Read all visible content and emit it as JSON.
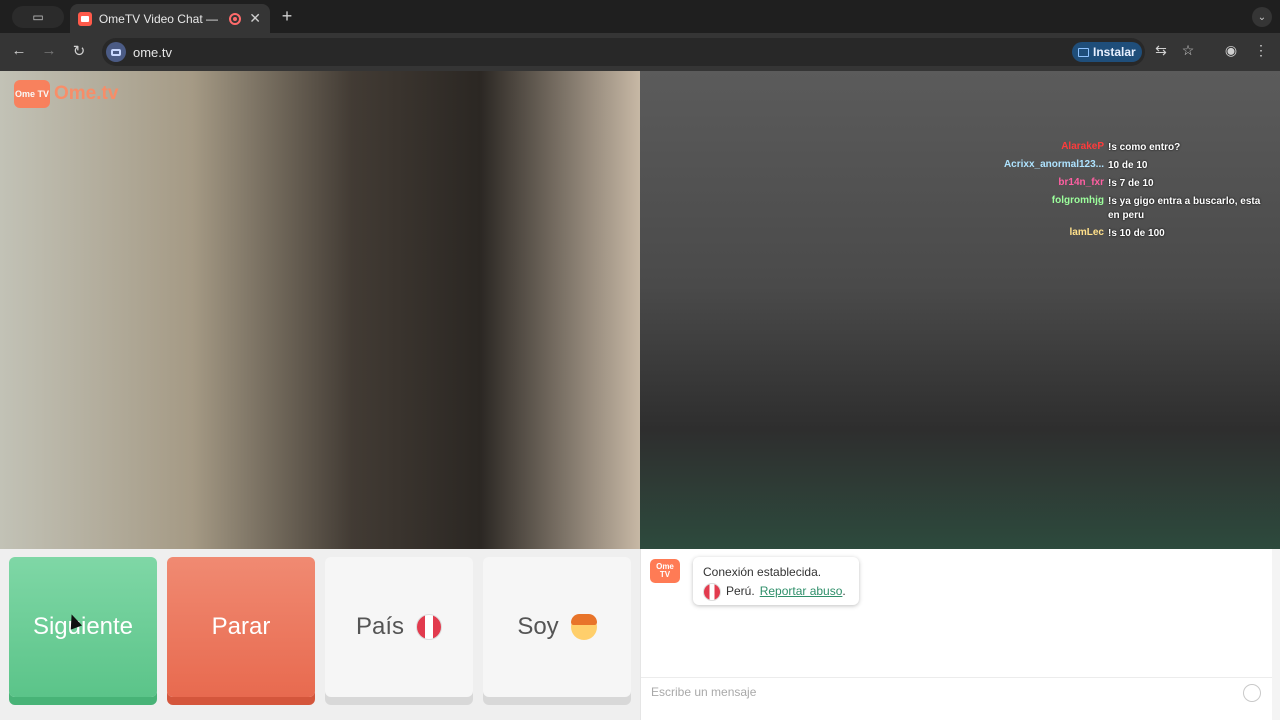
{
  "browser": {
    "tab_title": "OmeTV Video Chat — Ome",
    "tab_close": "✕",
    "new_tab": "+",
    "url": "ome.tv",
    "install_label": "Instalar"
  },
  "site": {
    "logo_icon_text": "Ome TV",
    "logo_text": "Ome.tv"
  },
  "stream_chat": [
    {
      "user": "AlarakeP",
      "message": "!s como entro?",
      "color": "#ff3b3b"
    },
    {
      "user": "Acrixx_anormal123...",
      "message": "10 de 10",
      "color": "#aee3ff"
    },
    {
      "user": "br14n_fxr",
      "message": "!s 7 de 10",
      "color": "#ff5fa2"
    },
    {
      "user": "folgromhjg",
      "message": "!s ya gigo entra a buscarlo, esta en peru",
      "color": "#9cff9c"
    },
    {
      "user": "lamLec",
      "message": "!s 10 de 100",
      "color": "#ffe08a"
    }
  ],
  "controls": {
    "next_label": "Siguiente",
    "stop_label": "Parar",
    "country_label": "País",
    "gender_label": "Soy"
  },
  "chat": {
    "avatar_text": "Ome TV",
    "system_line1": "Conexión establecida.",
    "country_name": "Perú.",
    "report_link": "Reportar abuso",
    "report_suffix": ".",
    "input_placeholder": "Escribe un mensaje"
  }
}
